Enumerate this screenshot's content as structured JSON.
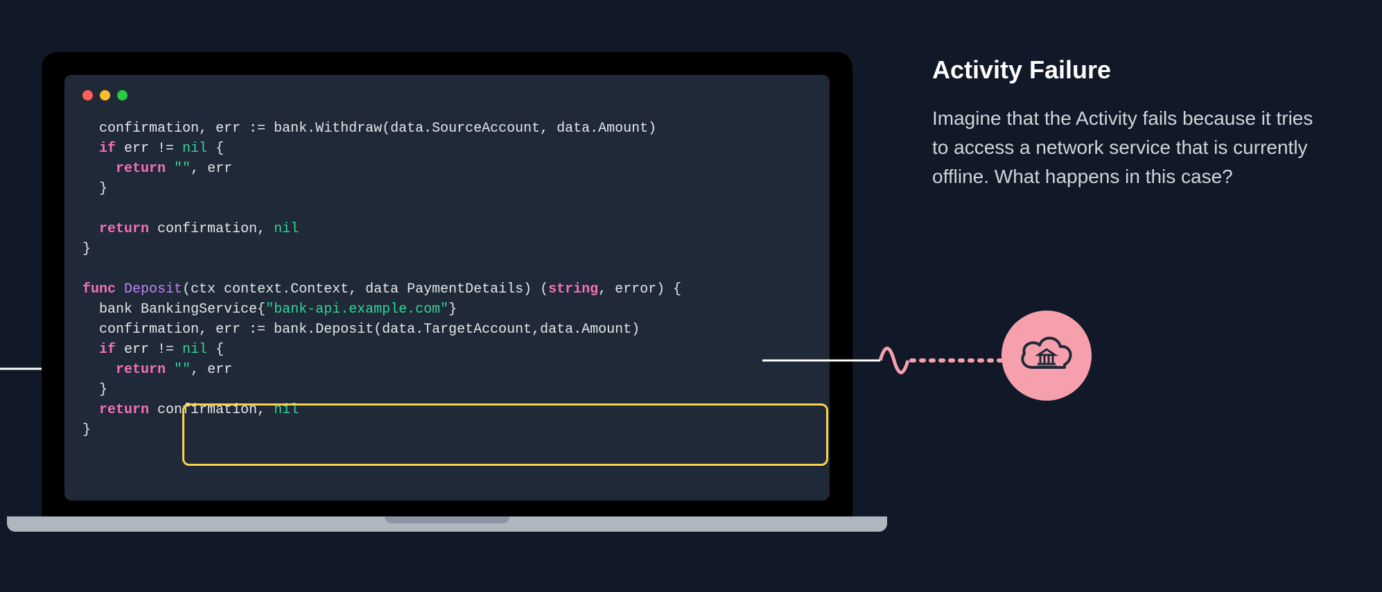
{
  "right_panel": {
    "heading": "Activity Failure",
    "body": "Imagine that the Activity fails because it tries to access a network service that is currently offline. What happens in this case?"
  },
  "code": {
    "line1_indent": "  ",
    "line1_a": "confirmation, err := bank.Withdraw(data.SourceAccount, data.Amount)",
    "line2_indent": "  ",
    "line2_kw": "if",
    "line2_rest": " err != ",
    "line2_nil": "nil",
    "line2_brace": " {",
    "line3_indent": "    ",
    "line3_kw": "return",
    "line3_space": " ",
    "line3_str": "\"\"",
    "line3_rest": ", err",
    "line4_indent": "  ",
    "line4_brace": "}",
    "line6_indent": "  ",
    "line6_kw": "return",
    "line6_rest": " confirmation, ",
    "line6_nil": "nil",
    "line7_brace": "}",
    "line9_kw": "func",
    "line9_space": " ",
    "line9_fn": "Deposit",
    "line9_sig_a": "(ctx context.Context, data PaymentDetails) (",
    "line9_kw2": "string",
    "line9_sig_b": ", error) {",
    "line10_indent": "  ",
    "line10_a": "bank BankingService{",
    "line10_str": "\"bank-api.example.com\"",
    "line10_b": "}",
    "line11_indent": "  ",
    "line11_a": "confirmation, err := bank.Deposit(data.TargetAccount,data.Amount)",
    "line12_indent": "  ",
    "line12_kw": "if",
    "line12_rest": " err != ",
    "line12_nil": "nil",
    "line12_brace": " {",
    "line13_indent": "    ",
    "line13_kw": "return",
    "line13_space": " ",
    "line13_str": "\"\"",
    "line13_rest": ", err",
    "line14_indent": "  ",
    "line14_brace": "}",
    "line15_indent": "  ",
    "line15_kw": "return",
    "line15_rest": " confirmation, ",
    "line15_nil": "nil",
    "line16_brace": "}"
  },
  "icons": {
    "traffic_red": "close-dot",
    "traffic_yellow": "minimize-dot",
    "traffic_green": "expand-dot",
    "cloud": "bank-cloud-icon"
  }
}
